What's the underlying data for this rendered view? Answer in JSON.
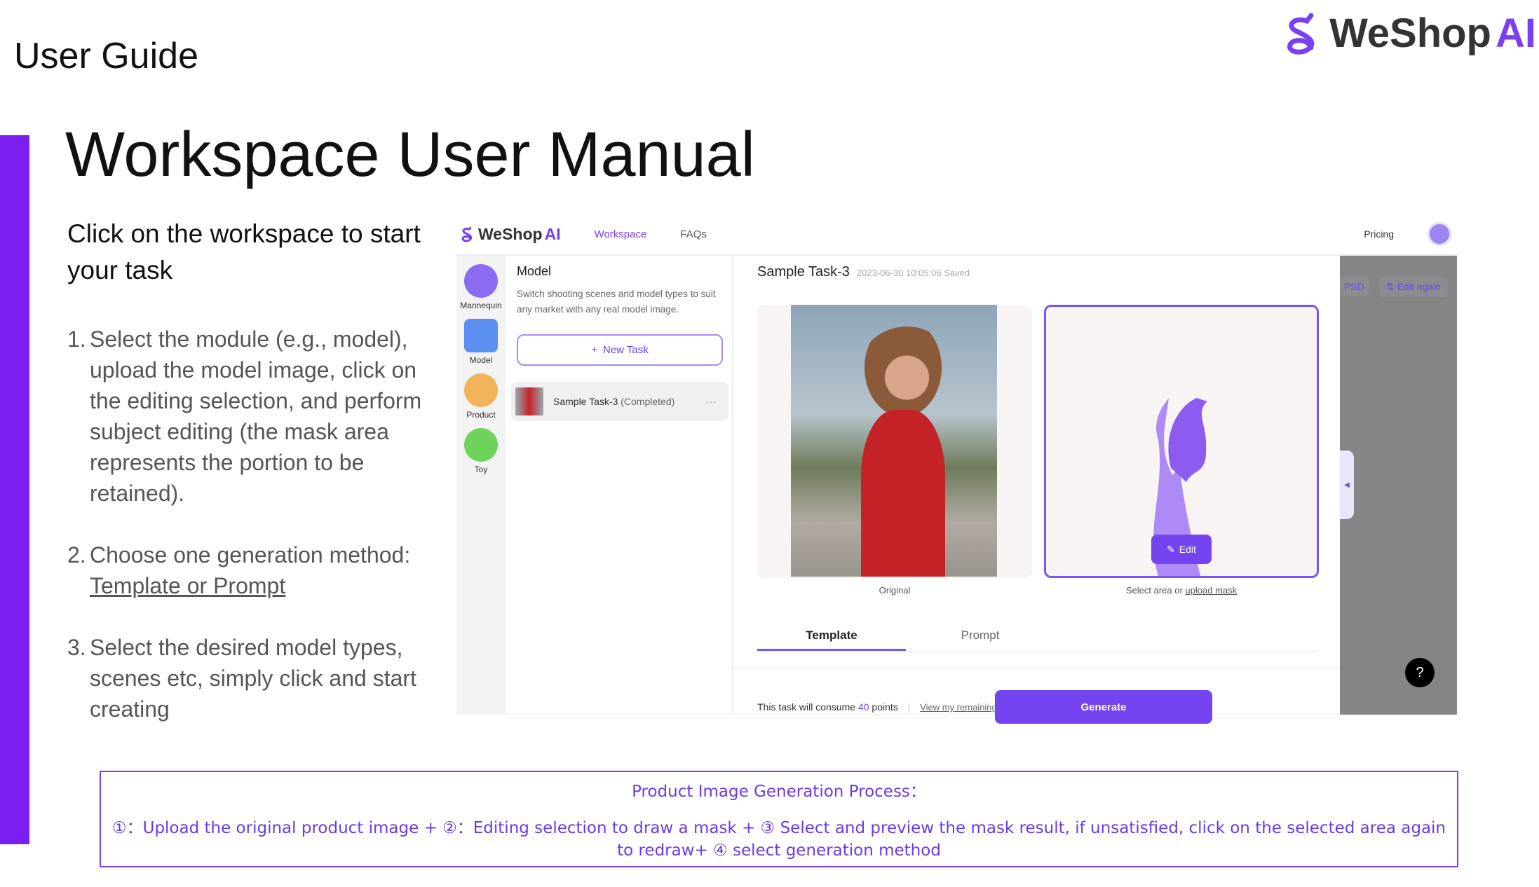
{
  "slide": {
    "header": "User Guide",
    "title": "Workspace User Manual",
    "intro": "Click on the workspace to start your task",
    "steps": [
      {
        "num": "1.",
        "text": "Select the module (e.g., model), upload the model image, click on the editing selection, and perform subject editing (the mask area represents the portion to be retained)."
      },
      {
        "num": "2.",
        "text": "Choose one generation method:",
        "link": "Template or Prompt"
      },
      {
        "num": "3.",
        "text": "Select the desired model types, scenes etc, simply click and start creating"
      }
    ],
    "logo": {
      "brand": "WeShop",
      "suffix": "AI"
    }
  },
  "app": {
    "nav": {
      "logo_brand": "WeShop",
      "logo_suffix": "AI",
      "workspace": "Workspace",
      "faqs": "FAQs",
      "pricing": "Pricing"
    },
    "rail": [
      {
        "label": "Mannequin",
        "color": "#8b6cf0"
      },
      {
        "label": "Model",
        "color": "#5b8ff0"
      },
      {
        "label": "Product",
        "color": "#f3b35a"
      },
      {
        "label": "Toy",
        "color": "#6ed35a"
      }
    ],
    "panel": {
      "title": "Model",
      "desc": "Switch shooting scenes and model types to suit any market with any real model image.",
      "new_task": "New Task",
      "task_name": "Sample Task-3",
      "task_status": "(Completed)",
      "more": "···"
    },
    "main": {
      "task_title": "Sample Task-3",
      "saved": "2023-06-30 10:05:06 Saved",
      "original_label": "Original",
      "select_text": "Select area or",
      "upload_mask": "upload mask",
      "edit": "Edit",
      "tabs": [
        "Template",
        "Prompt"
      ],
      "active_tab": "Template",
      "consume_prefix": "This task will consume",
      "points": "40",
      "consume_suffix": "points",
      "view_points": "View my remaining points",
      "generate": "Generate"
    },
    "overlay": {
      "psd": "PSD",
      "edit_again": "Edit again",
      "help": "?"
    },
    "accent": "#7344f0"
  },
  "process": {
    "title": "Product Image Generation Process：",
    "body": "①：Upload the original product image + ②：Editing selection to draw a mask + ③ Select and preview the mask result, if unsatisfied, click on the selected area again to redraw+  ④ select generation method"
  }
}
